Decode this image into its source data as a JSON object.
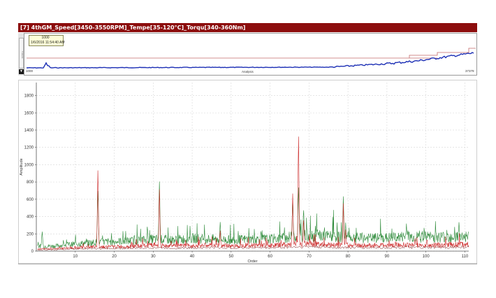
{
  "window": {
    "title": "[7] 4thGM_Speed[3450-3550RPM]_Tempe[35-120°C]_Torqu[340-360Nm]"
  },
  "trend": {
    "tooltip_value": "1000",
    "tooltip_time": "1/6/2016 11:54:40 AM",
    "x_start": "1000",
    "x_end": "37379",
    "x_label": "Analysis",
    "scroll_label": "Y-Zoom",
    "colors": {
      "line": "#1c2fb5",
      "limit": "#c46a6a"
    }
  },
  "chart_data": {
    "type": "line",
    "xlabel": "Order",
    "ylabel": "Amplitude",
    "xlim": [
      0,
      111
    ],
    "ylim": [
      0,
      1950
    ],
    "xticks": [
      10,
      20,
      30,
      40,
      50,
      60,
      70,
      80,
      90,
      100,
      110
    ],
    "yticks": [
      0,
      200,
      400,
      600,
      800,
      1000,
      1200,
      1400,
      1600,
      1800
    ],
    "grid": true,
    "colors": {
      "series_a": "#2e8b3a",
      "series_b": "#cc2a2a",
      "series_c": "#7a1a1a"
    },
    "peaks_a": [
      [
        1.5,
        230
      ],
      [
        15.8,
        700
      ],
      [
        28.5,
        300
      ],
      [
        31.6,
        810
      ],
      [
        47.2,
        340
      ],
      [
        65.8,
        640
      ],
      [
        67.3,
        790
      ],
      [
        68.6,
        520
      ],
      [
        78.8,
        640
      ],
      [
        79.4,
        330
      ],
      [
        95,
        320
      ],
      [
        108.5,
        350
      ]
    ],
    "peaks_b": [
      [
        15.8,
        940
      ],
      [
        31.6,
        720
      ],
      [
        47.2,
        240
      ],
      [
        65.8,
        700
      ],
      [
        67.3,
        1440
      ],
      [
        68.6,
        400
      ],
      [
        78.8,
        560
      ],
      [
        79.4,
        250
      ]
    ],
    "envelope_a": [
      [
        0,
        60
      ],
      [
        5,
        65
      ],
      [
        10,
        90
      ],
      [
        15,
        110
      ],
      [
        20,
        120
      ],
      [
        25,
        130
      ],
      [
        30,
        150
      ],
      [
        35,
        140
      ],
      [
        40,
        160
      ],
      [
        45,
        150
      ],
      [
        50,
        140
      ],
      [
        55,
        150
      ],
      [
        60,
        150
      ],
      [
        65,
        175
      ],
      [
        70,
        200
      ],
      [
        75,
        185
      ],
      [
        80,
        170
      ],
      [
        85,
        160
      ],
      [
        90,
        165
      ],
      [
        95,
        180
      ],
      [
        100,
        175
      ],
      [
        105,
        180
      ],
      [
        110,
        185
      ]
    ],
    "envelope_b": [
      [
        0,
        25
      ],
      [
        5,
        30
      ],
      [
        10,
        45
      ],
      [
        15,
        55
      ],
      [
        20,
        55
      ],
      [
        25,
        60
      ],
      [
        30,
        75
      ],
      [
        35,
        65
      ],
      [
        40,
        70
      ],
      [
        45,
        75
      ],
      [
        50,
        65
      ],
      [
        55,
        75
      ],
      [
        60,
        70
      ],
      [
        65,
        85
      ],
      [
        70,
        95
      ],
      [
        75,
        80
      ],
      [
        80,
        75
      ],
      [
        85,
        70
      ],
      [
        90,
        75
      ],
      [
        95,
        80
      ],
      [
        100,
        70
      ],
      [
        105,
        80
      ],
      [
        110,
        85
      ]
    ]
  }
}
